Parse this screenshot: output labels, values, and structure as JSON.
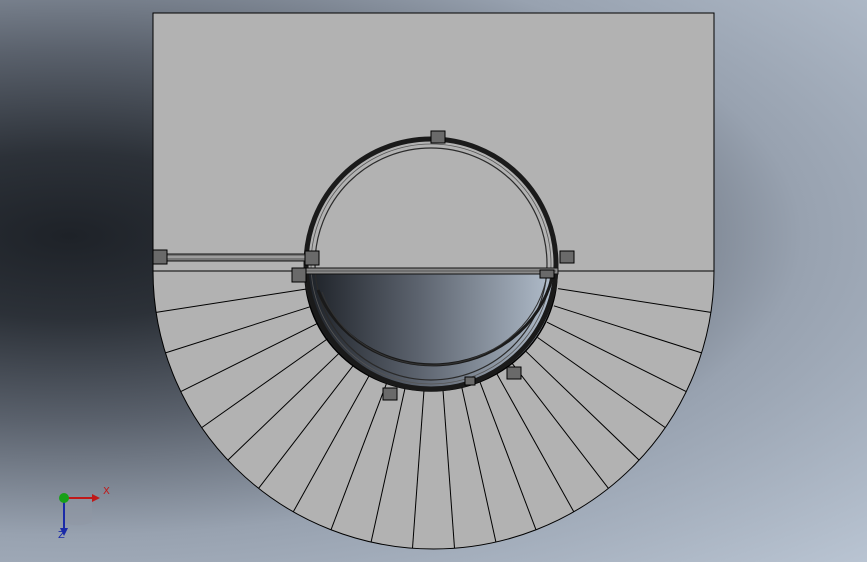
{
  "viewport": {
    "background_colors": [
      "#1e2228",
      "#5a616c",
      "#b9c4d2"
    ],
    "part_fill": "#b2b2b2",
    "edge_color": "#000000",
    "curved_ramp_steps": 21,
    "model": "spiral-staircase-top-view"
  },
  "triad": {
    "x_label": "X",
    "z_label": "Z",
    "x_color": "#c01818",
    "y_color": "#18a018",
    "z_color": "#1a2aa8",
    "icon": "coordinate-triad-icon"
  }
}
